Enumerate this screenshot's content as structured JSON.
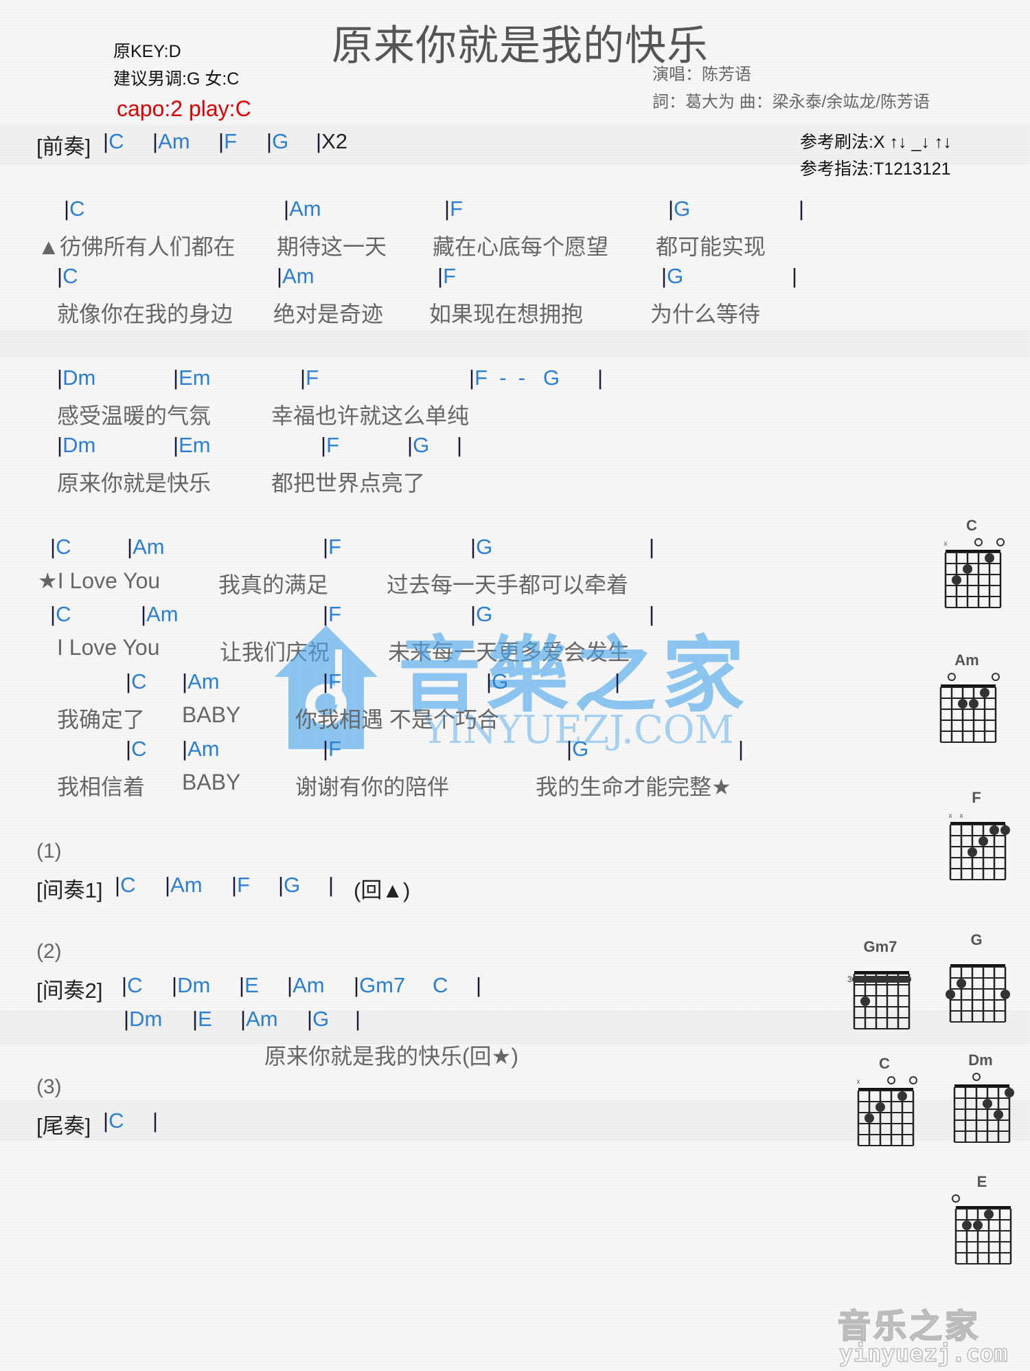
{
  "title": "原来你就是我的快乐",
  "meta": {
    "original_key": "原KEY:D",
    "suggested_key": "建议男调:G 女:C",
    "capo": "capo:2 play:C",
    "singer": "演唱：陈芳语",
    "credits": "詞：葛大为   曲：梁永泰/余竑龙/陈芳语",
    "strum": "参考刷法:X ↑↓ _↓ ↑↓",
    "picking": "参考指法:T1213121"
  },
  "intro": {
    "label": "[前奏]",
    "chords": [
      "C",
      "Am",
      "F",
      "G"
    ],
    "repeat": "X2"
  },
  "verse": [
    {
      "chords": [
        "C",
        "Am",
        "F",
        "G"
      ],
      "lyrics": [
        "▲彷佛所有人们都在",
        "期待这一天",
        "藏在心底每个愿望",
        "都可能实现"
      ]
    },
    {
      "chords": [
        "C",
        "Am",
        "F",
        "G"
      ],
      "lyrics": [
        "就像你在我的身边",
        "绝对是奇迹",
        "如果现在想拥抱",
        "为什么等待"
      ]
    }
  ],
  "prechorus": [
    {
      "chords": [
        "Dm",
        "Em",
        "F",
        "F  -  -   G"
      ],
      "lyrics": [
        "感受温暖的气氛",
        "幸福也许就这么单纯"
      ]
    },
    {
      "chords": [
        "Dm",
        "Em",
        "F",
        "G"
      ],
      "lyrics": [
        "原来你就是快乐",
        "都把世界点亮了"
      ]
    }
  ],
  "chorus": [
    {
      "chords": [
        "C",
        "Am",
        "F",
        "G"
      ],
      "lyrics": [
        "★I Love You",
        "我真的满足",
        "过去每一天手都可以牵着"
      ]
    },
    {
      "chords": [
        "C",
        "Am",
        "F",
        "G"
      ],
      "lyrics": [
        "I Love You",
        "让我们庆祝",
        "未来每一天更多爱会发生"
      ]
    },
    {
      "chords": [
        "C",
        "Am",
        "F",
        "G"
      ],
      "lyrics": [
        "我确定了",
        "BABY",
        "你我相遇 不是个巧合"
      ]
    },
    {
      "chords": [
        "C",
        "Am",
        "F",
        "G"
      ],
      "lyrics": [
        "我相信着",
        "BABY",
        "谢谢有你的陪伴",
        "我的生命才能完整★"
      ]
    }
  ],
  "section1": {
    "number": "(1)",
    "label": "[间奏1]",
    "chords": [
      "C",
      "Am",
      "F",
      "G"
    ],
    "note": "(回▲)"
  },
  "section2": {
    "number": "(2)",
    "label": "[间奏2]",
    "line1_chords": [
      "C",
      "Dm",
      "E",
      "Am",
      "Gm7",
      "C"
    ],
    "line2_chords": [
      "Dm",
      "E",
      "Am",
      "G"
    ],
    "lyric": "原来你就是我的快乐(回★)"
  },
  "section3": {
    "number": "(3)",
    "label": "[尾奏]",
    "chords": [
      "C"
    ]
  },
  "chord_diagrams": [
    {
      "name": "C",
      "markers": [
        "x",
        "",
        "",
        "o",
        "",
        "o"
      ],
      "dots": [
        [
          5,
          3
        ],
        [
          4,
          2
        ],
        [
          2,
          1
        ]
      ],
      "base_fret": ""
    },
    {
      "name": "Am",
      "markers": [
        "",
        "o",
        "",
        "",
        "",
        "o"
      ],
      "dots": [
        [
          4,
          2
        ],
        [
          3,
          2
        ],
        [
          2,
          1
        ]
      ],
      "base_fret": ""
    },
    {
      "name": "F",
      "markers": [
        "x",
        "x",
        "",
        "",
        "",
        ""
      ],
      "dots": [
        [
          4,
          3
        ],
        [
          3,
          2
        ],
        [
          2,
          1
        ],
        [
          1,
          1
        ]
      ],
      "base_fret": ""
    },
    {
      "name": "Gm7",
      "markers": [
        "",
        "",
        "",
        "",
        "",
        ""
      ],
      "dots": [
        [
          5,
          3
        ]
      ],
      "barre": 1,
      "base_fret": "3"
    },
    {
      "name": "G",
      "markers": [
        "",
        "",
        "",
        "",
        "",
        ""
      ],
      "dots": [
        [
          6,
          3
        ],
        [
          5,
          2
        ],
        [
          1,
          3
        ]
      ],
      "base_fret": ""
    },
    {
      "name": "C",
      "markers": [
        "x",
        "",
        "",
        "o",
        "",
        "o"
      ],
      "dots": [
        [
          5,
          3
        ],
        [
          4,
          2
        ],
        [
          2,
          1
        ]
      ],
      "base_fret": ""
    },
    {
      "name": "Dm",
      "markers": [
        "",
        "",
        "o",
        "",
        "",
        ""
      ],
      "dots": [
        [
          3,
          2
        ],
        [
          2,
          3
        ],
        [
          1,
          1
        ]
      ],
      "base_fret": ""
    },
    {
      "name": "E",
      "markers": [
        "o",
        "",
        "",
        "",
        "",
        ""
      ],
      "dots": [
        [
          5,
          2
        ],
        [
          4,
          2
        ],
        [
          3,
          1
        ]
      ],
      "base_fret": ""
    }
  ],
  "watermark": {
    "chinese": "音樂之家",
    "latin": "YINYUEZJ.COM"
  },
  "footer_logo": {
    "chinese": "音乐之家",
    "latin": "yinyuezj.com"
  }
}
